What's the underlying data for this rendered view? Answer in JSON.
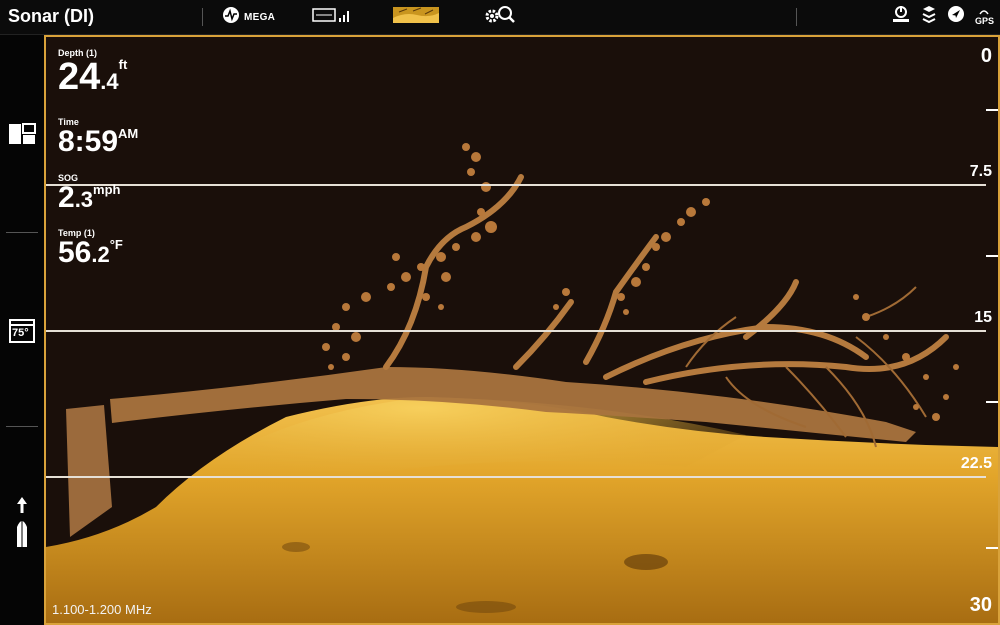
{
  "app": {
    "title": "Sonar (DI)"
  },
  "toolbar": {
    "mega_label": "MEGA",
    "icons": [
      "mega-icon",
      "chart-signal-icon",
      "sonar-thumbnail-icon",
      "settings-search-icon"
    ]
  },
  "status": {
    "gps_label": "GPS",
    "icons": [
      "power-icon",
      "layers-icon",
      "navigation-icon",
      "gps-icon"
    ]
  },
  "sidebar": {
    "icons": [
      "split-view-icon",
      "temperature-icon",
      "boat-icon"
    ],
    "temp_badge": "75°"
  },
  "readouts": {
    "depth": {
      "label": "Depth (1)",
      "int": "24",
      "dec": ".4",
      "unit": "ft"
    },
    "time": {
      "label": "Time",
      "value": "8:59",
      "unit": "AM"
    },
    "sog": {
      "label": "SOG",
      "int": "2",
      "dec": ".3",
      "unit": "mph"
    },
    "temp": {
      "label": "Temp (1)",
      "int": "56",
      "dec": ".2",
      "unit": "°F"
    }
  },
  "scale": {
    "top": "0",
    "bottom": "30",
    "labels": [
      "7.5",
      "15",
      "22.5"
    ]
  },
  "frequency": "1.100-1.200 MHz",
  "colors": {
    "accent": "#d9a23a",
    "sonar_bg": "#1a0f0a",
    "bottom": "#e2a52a"
  }
}
